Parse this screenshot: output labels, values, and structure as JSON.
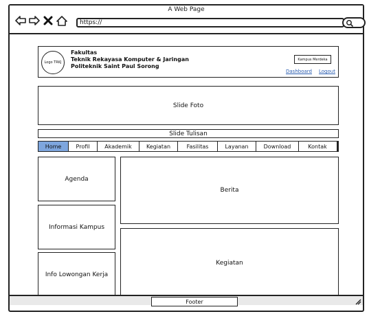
{
  "window": {
    "title": "A Web Page"
  },
  "browser": {
    "url": "https://",
    "icons": [
      "back-arrow-icon",
      "forward-arrow-icon",
      "close-x-icon",
      "home-icon",
      "search-icon"
    ]
  },
  "header": {
    "logo_text": "Logo TRKJ",
    "org_line1": "Fakultas",
    "org_line2": "Teknik Rekayasa Komputer & Jaringan",
    "org_line3": "Politeknik Saint Paul Sorong",
    "kampus_button": "Kampus Merdeka",
    "dashboard_link": "Dashboard",
    "logout_link": "Logout"
  },
  "slide_foto": "Slide Foto",
  "slide_tulisan": "Slide Tulisan",
  "menu": {
    "active": "Home",
    "active_color": "#7ea6de",
    "items": [
      {
        "label": "Home"
      },
      {
        "label": "Profil"
      },
      {
        "label": "Akademik"
      },
      {
        "label": "Kegiatan"
      },
      {
        "label": "Fasilitas"
      },
      {
        "label": "Layanan"
      },
      {
        "label": "Download"
      },
      {
        "label": "Kontak"
      }
    ]
  },
  "sidebar": {
    "agenda": "Agenda",
    "info_kampus": "Informasi Kampus",
    "info_loker": "Info Lowongan Kerja"
  },
  "main": {
    "berita": "Berita",
    "kegiatan": "Kegiatan"
  },
  "footer": "Footer"
}
